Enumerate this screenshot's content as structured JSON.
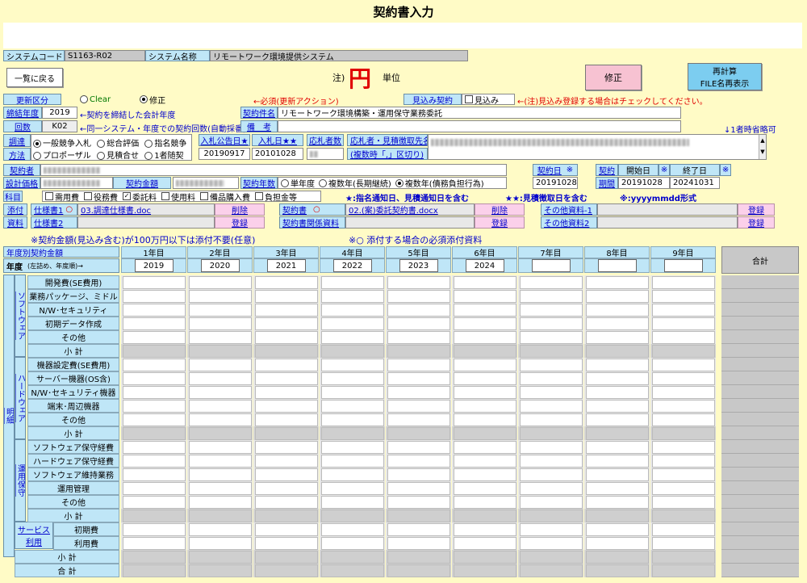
{
  "title": "契約書入力",
  "system": {
    "code_label": "システムコード",
    "code": "S1163-R02",
    "name_label": "システム名称",
    "name": "リモートワーク環境提供システム"
  },
  "buttons": {
    "back": "一覧に戻る",
    "modify": "修正",
    "recalc_line1": "再計算",
    "recalc_line2": "FILE名再表示"
  },
  "unit": {
    "note": "注)",
    "currency": "円",
    "label": "単位"
  },
  "update": {
    "label": "更新区分",
    "opt_clear": "Clear",
    "opt_modify": "修正",
    "required_note": "←必須(更新アクション)",
    "estimate_label": "見込み契約",
    "estimate_chk": "見込み",
    "estimate_note": "←(注)見込み登録する場合はチェックしてください。"
  },
  "year": {
    "label": "締結年度",
    "value": "2019",
    "note": "←契約を締結した会計年度",
    "subject_label": "契約件名",
    "subject": "リモートワーク環境構築・運用保守業務委託"
  },
  "round": {
    "label": "回数",
    "value": "K02",
    "note": "←同一システム・年度での契約回数(自動採番)",
    "remark_label": "備　考",
    "omit_note": "↓1者時省略可"
  },
  "procure": {
    "label1": "調達",
    "label2": "方法",
    "opt1": "一般競争入札",
    "opt2": "総合評価",
    "opt3": "指名競争",
    "opt4": "プロポーザル",
    "opt5": "見積合せ",
    "opt6": "1者随契",
    "bid_pub_label": "入札公告日★",
    "bid_pub": "20190917",
    "bid_date_label": "入札日★★",
    "bid_date": "20101028",
    "applicants_label": "応札者数",
    "quoters_label": "応札者・見積徴取先名",
    "quoters_sub": "(複数時「,」区切り)"
  },
  "contractor": {
    "label": "契約者",
    "amount_label": "設計価格",
    "contract_amount_label": "契約金額",
    "years_label": "契約年数",
    "opt_single": "単年度",
    "opt_multi_long": "複数年(長期継続)",
    "opt_multi_debt": "複数年(債務負担行為)",
    "date_label": "契約日",
    "date_mark": "※",
    "date": "20191028",
    "period_label1": "契約",
    "period_label2": "期間",
    "period_mark": "※",
    "start_label": "開始日",
    "end_label": "終了日",
    "start": "20191028",
    "end": "20241031"
  },
  "subject_row": {
    "label": "科目",
    "items": [
      "需用費",
      "役務費",
      "委託料",
      "使用料",
      "備品購入費",
      "負担金等"
    ],
    "checked": [
      false,
      false,
      true,
      false,
      false,
      false
    ],
    "note1": "★:指名通知日、見積通知日を含む",
    "note2": "★★:見積徴取日を含む",
    "note3": "※:yyyymmdd形式"
  },
  "attach": {
    "label1": "添付",
    "label2": "資料",
    "spec1_label": "仕様書1",
    "spec1_mark": "○",
    "spec1_file": "03.調達仕様書.doc",
    "spec2_label": "仕様書2",
    "delete": "削除",
    "register": "登録",
    "contract_label": "契約書",
    "contract_mark": "○",
    "contract_file": "02.(案)委託契約書.docx",
    "contract_rel_label": "契約書関係資料",
    "other1_label": "その他資料-1",
    "other2_label": "その他資料2"
  },
  "notes": {
    "left": "※契約金額(見込み含む)が100万円以下は添付不要(任意)",
    "right": "※○ 添付する場合の必須添付資料"
  },
  "table": {
    "header_label": "年度別契約金額",
    "year_row_label": "年度",
    "year_row_sub": "(左詰め、年度順)→",
    "years": [
      "1年目",
      "2年目",
      "3年目",
      "4年目",
      "5年目",
      "6年目",
      "7年目",
      "8年目",
      "9年目"
    ],
    "year_values": [
      "2019",
      "2020",
      "2021",
      "2022",
      "2023",
      "2024",
      "",
      "",
      ""
    ],
    "total": "合計",
    "meisai": "明細",
    "software": "ソフトウェア",
    "hardware": "ハードウェア",
    "ops": "運用保守",
    "service": "サービス利用",
    "rows": [
      "開発費(SE費用)",
      "業務パッケージ、ミドル",
      "N/W･セキュリティ",
      "初期データ作成",
      "その他",
      "小 計",
      "機器設定費(SE費用)",
      "サーバー機器(OS含)",
      "N/W･セキュリティ機器",
      "端末･周辺機器",
      "その他",
      "小 計",
      "ソフトウェア保守経費",
      "ハードウェア保守経費",
      "ソフトウェア維持業務",
      "運用管理",
      "その他",
      "小 計",
      "初期費",
      "利用費",
      "小 計",
      "合 計"
    ]
  }
}
